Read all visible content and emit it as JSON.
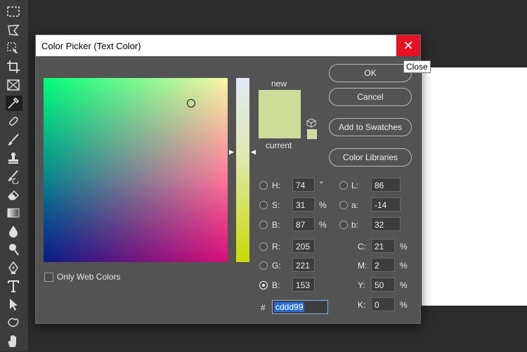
{
  "toolbar": {
    "tools": [
      "marquee-icon",
      "lasso-icon",
      "object-select-icon",
      "crop-icon",
      "frame-icon",
      "eyedropper-icon",
      "healing-icon",
      "brush-icon",
      "clone-stamp-icon",
      "history-brush-icon",
      "eraser-icon",
      "gradient-icon",
      "blur-icon",
      "dodge-icon",
      "pen-icon",
      "type-icon",
      "path-select-icon",
      "shape-icon",
      "hand-icon"
    ],
    "active_tool": "eyedropper-icon"
  },
  "dialog": {
    "title": "Color Picker (Text Color)",
    "close_label": "✕",
    "tooltip": "Close",
    "new_label": "new",
    "current_label": "current",
    "new_color": "#cddd99",
    "current_color": "#cddd99",
    "buttons": {
      "ok": "OK",
      "cancel": "Cancel",
      "add_to_swatches": "Add to Swatches",
      "color_libraries": "Color Libraries"
    },
    "only_web_colors": "Only Web Colors",
    "hsb": {
      "h_label": "H:",
      "h": "74",
      "h_unit": "°",
      "s_label": "S:",
      "s": "31",
      "s_unit": "%",
      "b_label": "B:",
      "b": "87",
      "b_unit": "%"
    },
    "rgb": {
      "r_label": "R:",
      "r": "205",
      "g_label": "G:",
      "g": "221",
      "b_label": "B:",
      "b": "153"
    },
    "lab": {
      "l_label": "L:",
      "l": "86",
      "a_label": "a:",
      "a": "-14",
      "b_label": "b:",
      "b": "32"
    },
    "cmyk": {
      "c_label": "C:",
      "c": "21",
      "m_label": "M:",
      "m": "2",
      "y_label": "Y:",
      "y": "50",
      "k_label": "K:",
      "k": "0",
      "unit": "%"
    },
    "hex_label": "#",
    "hex": "cddd99",
    "selected_channel": "B"
  }
}
